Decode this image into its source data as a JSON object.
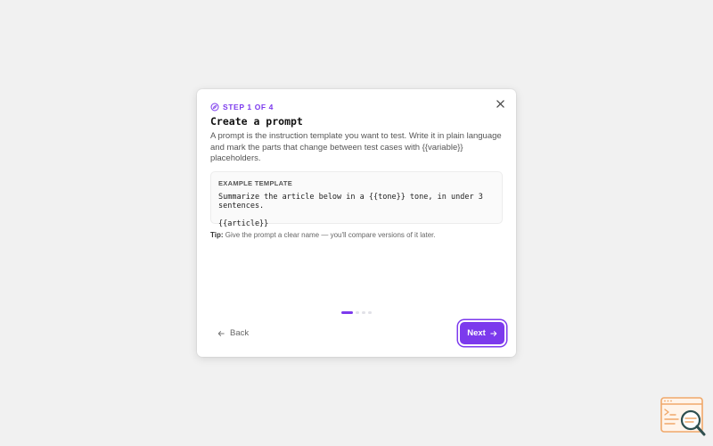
{
  "wizard": {
    "step_label": "STEP 1 OF 4",
    "title": "Create a prompt",
    "description": "A prompt is the instruction template you want to test. Write it in plain language and mark the parts that change between test cases with {{variable}} placeholders.",
    "example": {
      "label": "EXAMPLE TEMPLATE",
      "line1": "Summarize the article below in a {{tone}} tone, in under 3 sentences.",
      "line2": "{{article}}"
    },
    "tip_label": "Tip:",
    "tip_text": "Give the prompt a clear name — you'll compare versions of it later.",
    "progress": {
      "current_step": 1,
      "total_steps": 4
    },
    "back_label": "Back",
    "next_label": "Next"
  },
  "icons": {
    "close": "close-icon",
    "step": "compass-icon",
    "back": "arrow-left-icon",
    "next": "arrow-right-icon",
    "logo": "search-code-icon"
  },
  "colors": {
    "accent": "#7c3aed",
    "background": "#f1f1f1",
    "logo": "#f0a86a"
  }
}
